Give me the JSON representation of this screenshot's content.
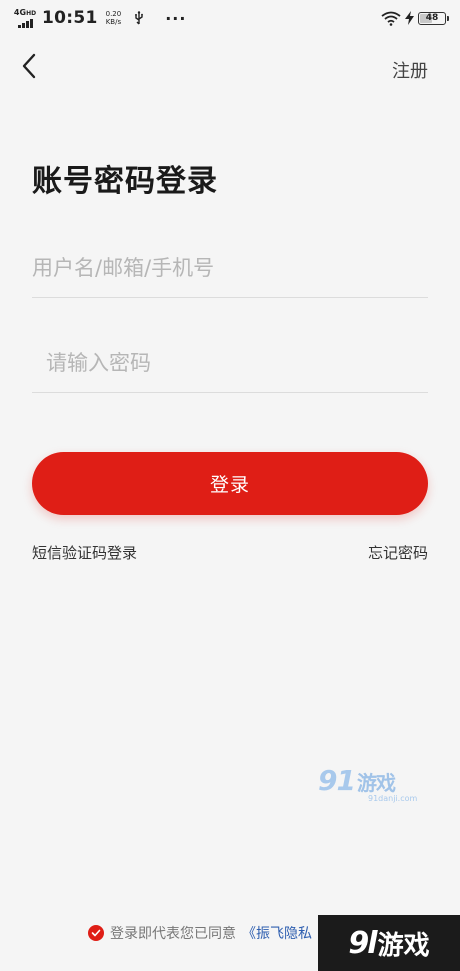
{
  "status_bar": {
    "network": "4G",
    "network_sub": "HD",
    "time": "10:51",
    "speed_value": "0.20",
    "speed_unit": "KB/s",
    "more": "···",
    "battery_level": "48",
    "battery_fraction": 0.48
  },
  "nav": {
    "back_icon": "chevron-left-icon",
    "register_label": "注册"
  },
  "page": {
    "title": "账号密码登录"
  },
  "form": {
    "username_placeholder": "用户名/邮箱/手机号",
    "username_value": "",
    "password_placeholder": "请输入密码",
    "password_value": "",
    "login_label": "登录"
  },
  "links": {
    "sms_login": "短信验证码登录",
    "forgot_password": "忘记密码"
  },
  "agreement": {
    "text": "登录即代表您已同意",
    "policy_link": "《振飞隐私"
  },
  "watermark": {
    "brand_number": "91",
    "brand_text": "游戏",
    "brand_url": "91danji.com",
    "badge_number": "9l",
    "badge_text": "游戏"
  },
  "colors": {
    "accent": "#df1e16",
    "background": "#f5f5f5",
    "link": "#2f5fb0"
  }
}
